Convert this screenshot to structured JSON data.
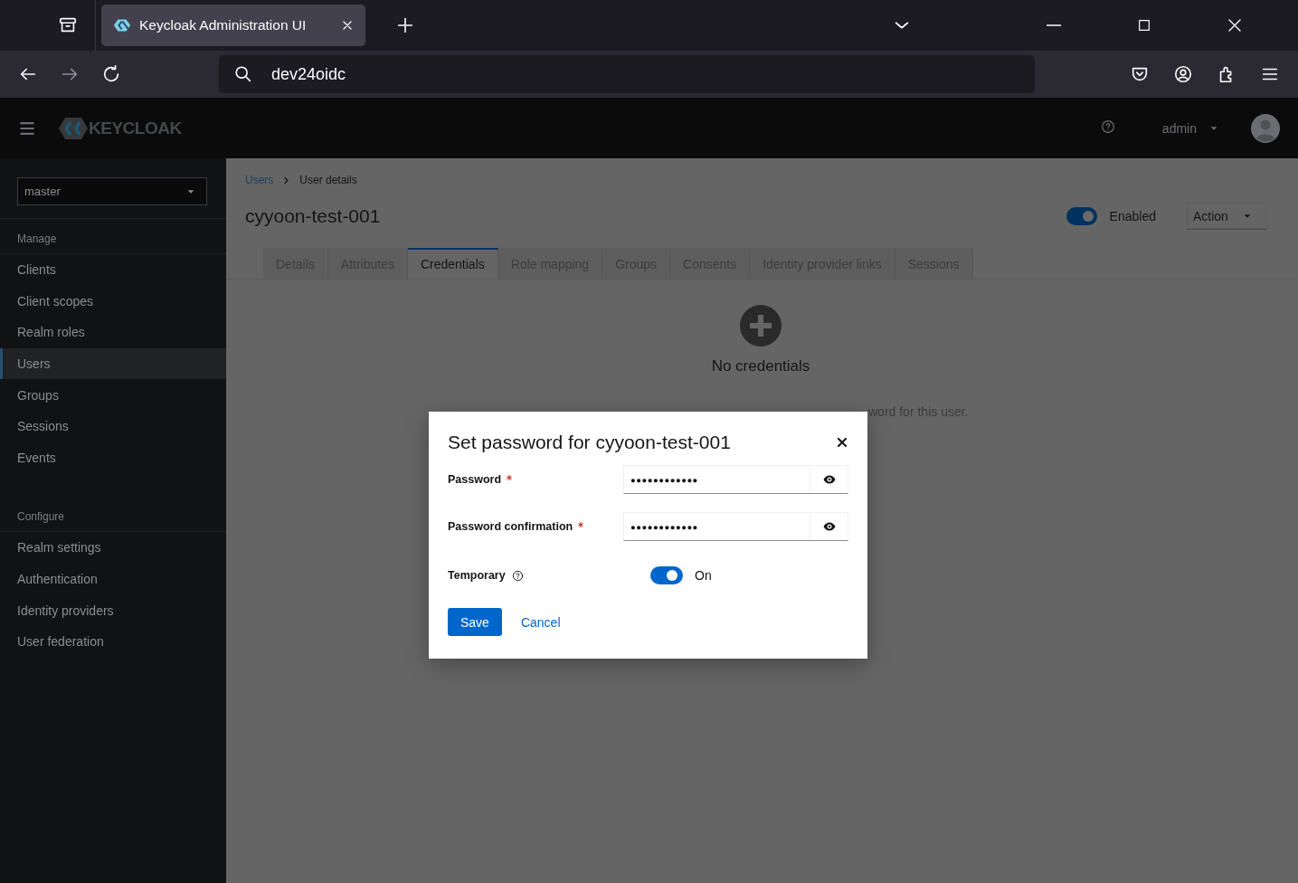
{
  "browser": {
    "tab_title": "Keycloak Administration UI",
    "address": "dev24oidc"
  },
  "header": {
    "logo_text": "KEYCLOAK",
    "user": "admin"
  },
  "sidebar": {
    "realm": "master",
    "sections": [
      {
        "title": "Manage",
        "items": [
          {
            "label": "Clients",
            "selected": false
          },
          {
            "label": "Client scopes",
            "selected": false
          },
          {
            "label": "Realm roles",
            "selected": false
          },
          {
            "label": "Users",
            "selected": true
          },
          {
            "label": "Groups",
            "selected": false
          },
          {
            "label": "Sessions",
            "selected": false
          },
          {
            "label": "Events",
            "selected": false
          }
        ]
      },
      {
        "title": "Configure",
        "items": [
          {
            "label": "Realm settings",
            "selected": false
          },
          {
            "label": "Authentication",
            "selected": false
          },
          {
            "label": "Identity providers",
            "selected": false
          },
          {
            "label": "User federation",
            "selected": false
          }
        ]
      }
    ]
  },
  "breadcrumb": [
    {
      "label": "Users",
      "kind": "link"
    },
    {
      "label": "User details",
      "kind": "current"
    }
  ],
  "page_title": "cyyoon-test-001",
  "enabled_toggle": {
    "label": "Enabled",
    "on": true
  },
  "action_button": "Action",
  "tabs": [
    {
      "label": "Details",
      "selected": false
    },
    {
      "label": "Attributes",
      "selected": false
    },
    {
      "label": "Credentials",
      "selected": true
    },
    {
      "label": "Role mapping",
      "selected": false
    },
    {
      "label": "Groups",
      "selected": false
    },
    {
      "label": "Consents",
      "selected": false
    },
    {
      "label": "Identity provider links",
      "selected": false
    },
    {
      "label": "Sessions",
      "selected": false
    }
  ],
  "empty_state": {
    "title": "No credentials",
    "description": "word for this user."
  },
  "dialog": {
    "title": "Set password for cyyoon-test-001",
    "fields": [
      {
        "label": "Password",
        "required": true,
        "value": "●●●●●●●●●●●●"
      },
      {
        "label": "Password confirmation",
        "required": true,
        "value": "●●●●●●●●●●●●"
      }
    ],
    "temporary": {
      "label": "Temporary",
      "on": true,
      "state_label": "On"
    },
    "buttons": [
      {
        "label": "Save",
        "kind": "primary"
      },
      {
        "label": "Cancel",
        "kind": "link"
      }
    ]
  }
}
